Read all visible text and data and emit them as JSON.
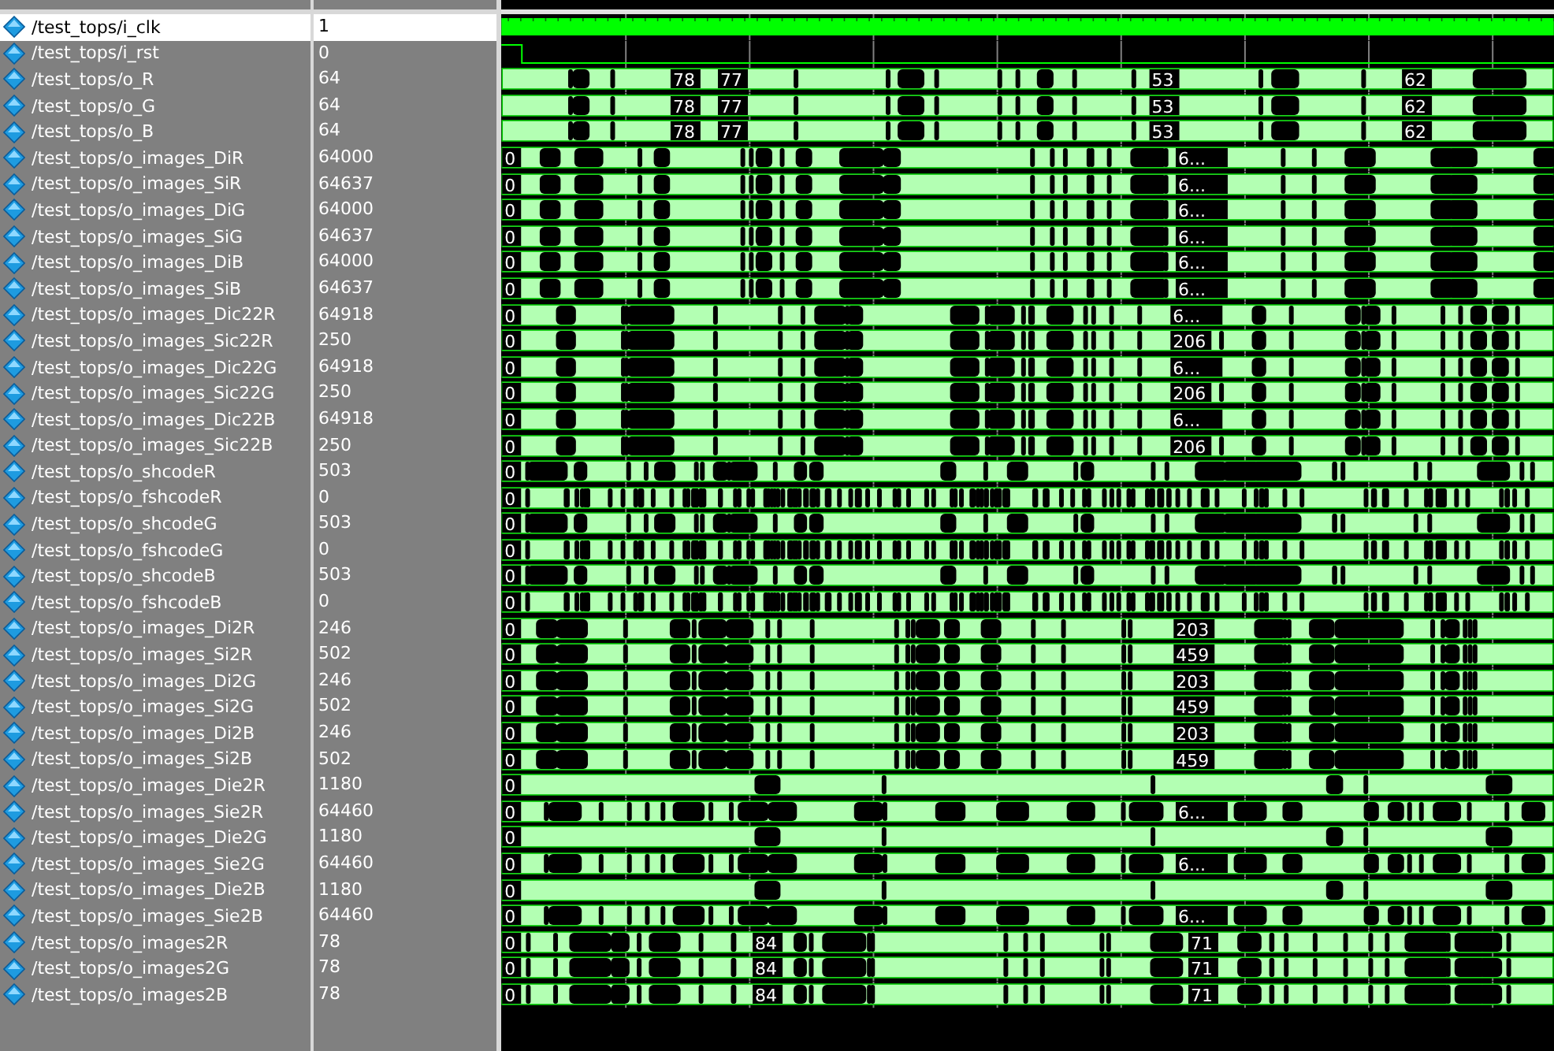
{
  "signals": [
    {
      "name": "/test_tops/i_clk",
      "value": "1",
      "kind": "clock",
      "selected": true
    },
    {
      "name": "/test_tops/i_rst",
      "value": "0",
      "kind": "bit",
      "selected": false
    },
    {
      "name": "/test_tops/o_R",
      "value": "64",
      "kind": "bus",
      "selected": false,
      "wave_labels": [
        "78",
        "77",
        "53",
        "62"
      ]
    },
    {
      "name": "/test_tops/o_G",
      "value": "64",
      "kind": "bus",
      "selected": false,
      "wave_labels": [
        "78",
        "77",
        "53",
        "62"
      ]
    },
    {
      "name": "/test_tops/o_B",
      "value": "64",
      "kind": "bus",
      "selected": false,
      "wave_labels": [
        "78",
        "77",
        "53",
        "62"
      ]
    },
    {
      "name": "/test_tops/o_images_DiR",
      "value": "64000",
      "kind": "bus",
      "selected": false,
      "wave_labels": [
        "0",
        "6..."
      ]
    },
    {
      "name": "/test_tops/o_images_SiR",
      "value": "64637",
      "kind": "bus",
      "selected": false,
      "wave_labels": [
        "0",
        "6..."
      ]
    },
    {
      "name": "/test_tops/o_images_DiG",
      "value": "64000",
      "kind": "bus",
      "selected": false,
      "wave_labels": [
        "0",
        "6..."
      ]
    },
    {
      "name": "/test_tops/o_images_SiG",
      "value": "64637",
      "kind": "bus",
      "selected": false,
      "wave_labels": [
        "0",
        "6..."
      ]
    },
    {
      "name": "/test_tops/o_images_DiB",
      "value": "64000",
      "kind": "bus",
      "selected": false,
      "wave_labels": [
        "0",
        "6..."
      ]
    },
    {
      "name": "/test_tops/o_images_SiB",
      "value": "64637",
      "kind": "bus",
      "selected": false,
      "wave_labels": [
        "0",
        "6..."
      ]
    },
    {
      "name": "/test_tops/o_images_Dic22R",
      "value": "64918",
      "kind": "bus",
      "selected": false,
      "wave_labels": [
        "0",
        "6..."
      ]
    },
    {
      "name": "/test_tops/o_images_Sic22R",
      "value": "250",
      "kind": "bus",
      "selected": false,
      "wave_labels": [
        "0",
        "206"
      ]
    },
    {
      "name": "/test_tops/o_images_Dic22G",
      "value": "64918",
      "kind": "bus",
      "selected": false,
      "wave_labels": [
        "0",
        "6..."
      ]
    },
    {
      "name": "/test_tops/o_images_Sic22G",
      "value": "250",
      "kind": "bus",
      "selected": false,
      "wave_labels": [
        "0",
        "206"
      ]
    },
    {
      "name": "/test_tops/o_images_Dic22B",
      "value": "64918",
      "kind": "bus",
      "selected": false,
      "wave_labels": [
        "0",
        "6..."
      ]
    },
    {
      "name": "/test_tops/o_images_Sic22B",
      "value": "250",
      "kind": "bus",
      "selected": false,
      "wave_labels": [
        "0",
        "206"
      ]
    },
    {
      "name": "/test_tops/o_shcodeR",
      "value": "503",
      "kind": "bus",
      "selected": false,
      "wave_labels": [
        "0"
      ]
    },
    {
      "name": "/test_tops/o_fshcodeR",
      "value": "0",
      "kind": "bus",
      "selected": false,
      "wave_labels": [
        "0"
      ]
    },
    {
      "name": "/test_tops/o_shcodeG",
      "value": "503",
      "kind": "bus",
      "selected": false,
      "wave_labels": [
        "0"
      ]
    },
    {
      "name": "/test_tops/o_fshcodeG",
      "value": "0",
      "kind": "bus",
      "selected": false,
      "wave_labels": [
        "0"
      ]
    },
    {
      "name": "/test_tops/o_shcodeB",
      "value": "503",
      "kind": "bus",
      "selected": false,
      "wave_labels": [
        "0"
      ]
    },
    {
      "name": "/test_tops/o_fshcodeB",
      "value": "0",
      "kind": "bus",
      "selected": false,
      "wave_labels": [
        "0"
      ]
    },
    {
      "name": "/test_tops/o_images_Di2R",
      "value": "246",
      "kind": "bus",
      "selected": false,
      "wave_labels": [
        "0",
        "203"
      ]
    },
    {
      "name": "/test_tops/o_images_Si2R",
      "value": "502",
      "kind": "bus",
      "selected": false,
      "wave_labels": [
        "0",
        "459"
      ]
    },
    {
      "name": "/test_tops/o_images_Di2G",
      "value": "246",
      "kind": "bus",
      "selected": false,
      "wave_labels": [
        "0",
        "203"
      ]
    },
    {
      "name": "/test_tops/o_images_Si2G",
      "value": "502",
      "kind": "bus",
      "selected": false,
      "wave_labels": [
        "0",
        "459"
      ]
    },
    {
      "name": "/test_tops/o_images_Di2B",
      "value": "246",
      "kind": "bus",
      "selected": false,
      "wave_labels": [
        "0",
        "203"
      ]
    },
    {
      "name": "/test_tops/o_images_Si2B",
      "value": "502",
      "kind": "bus",
      "selected": false,
      "wave_labels": [
        "0",
        "459"
      ]
    },
    {
      "name": "/test_tops/o_images_Die2R",
      "value": "1180",
      "kind": "bus",
      "selected": false,
      "wave_labels": [
        "0"
      ]
    },
    {
      "name": "/test_tops/o_images_Sie2R",
      "value": "64460",
      "kind": "bus",
      "selected": false,
      "wave_labels": [
        "0",
        "6..."
      ]
    },
    {
      "name": "/test_tops/o_images_Die2G",
      "value": "1180",
      "kind": "bus",
      "selected": false,
      "wave_labels": [
        "0"
      ]
    },
    {
      "name": "/test_tops/o_images_Sie2G",
      "value": "64460",
      "kind": "bus",
      "selected": false,
      "wave_labels": [
        "0",
        "6..."
      ]
    },
    {
      "name": "/test_tops/o_images_Die2B",
      "value": "1180",
      "kind": "bus",
      "selected": false,
      "wave_labels": [
        "0"
      ]
    },
    {
      "name": "/test_tops/o_images_Sie2B",
      "value": "64460",
      "kind": "bus",
      "selected": false,
      "wave_labels": [
        "0",
        "6..."
      ]
    },
    {
      "name": "/test_tops/o_images2R",
      "value": "78",
      "kind": "bus",
      "selected": false,
      "wave_labels": [
        "0",
        "84",
        "71"
      ]
    },
    {
      "name": "/test_tops/o_images2G",
      "value": "78",
      "kind": "bus",
      "selected": false,
      "wave_labels": [
        "0",
        "84",
        "71"
      ]
    },
    {
      "name": "/test_tops/o_images2B",
      "value": "78",
      "kind": "bus",
      "selected": false,
      "wave_labels": [
        "0",
        "84",
        "71"
      ]
    }
  ]
}
